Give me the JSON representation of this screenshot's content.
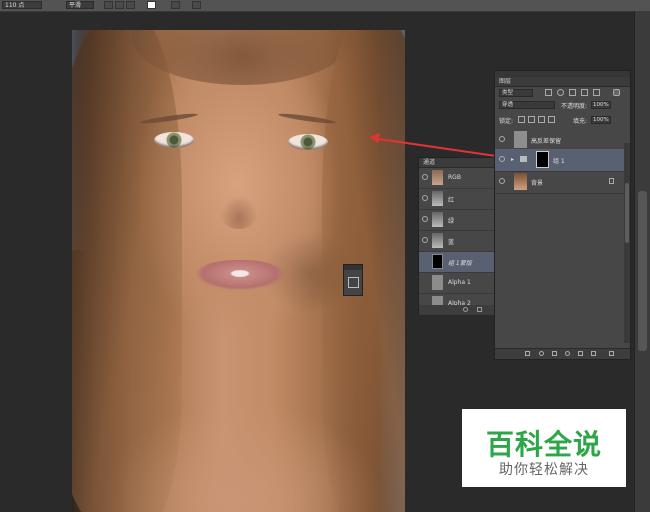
{
  "options_bar": {
    "font_size_value": "110 点",
    "antialias_value": "平滑"
  },
  "photo": {
    "description_alt": "portrait photo"
  },
  "annotation": {
    "arrow_color": "#e03434",
    "circle_color": "#d33030"
  },
  "channels_panel": {
    "title": "通道",
    "rows": [
      {
        "label": "RGB",
        "italic": false
      },
      {
        "label": "红",
        "italic": false
      },
      {
        "label": "绿",
        "italic": false
      },
      {
        "label": "蓝",
        "italic": false
      },
      {
        "label": "组 1蒙版",
        "italic": true
      },
      {
        "label": "Alpha 1",
        "italic": false
      },
      {
        "label": "Alpha 2",
        "italic": false
      }
    ]
  },
  "layers_panel": {
    "title": "图层",
    "filter_kind": "类型",
    "blend_mode": "穿透",
    "opacity_label": "不透明度:",
    "opacity_value": "100%",
    "lock_label": "锁定:",
    "fill_label": "填充:",
    "fill_value": "100%",
    "layers": [
      {
        "name": "高反差保留"
      },
      {
        "name": "组 1"
      },
      {
        "name": "背景"
      }
    ]
  },
  "watermark": {
    "title": "百科全说",
    "subtitle": "助你轻松解决"
  }
}
